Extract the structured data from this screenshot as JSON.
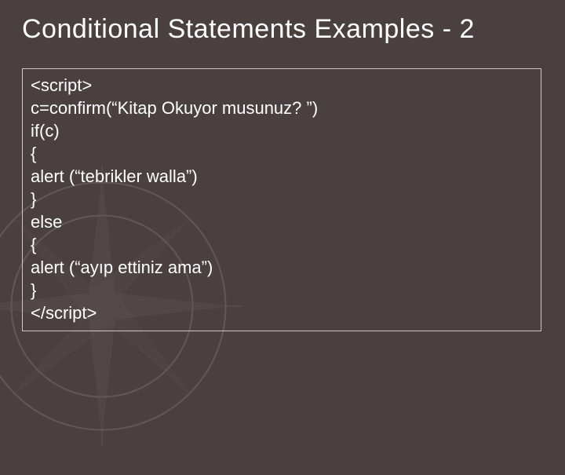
{
  "slide": {
    "title": "Conditional Statements Examples - 2",
    "code": {
      "line1": "<script>",
      "line2": "c=confirm(“Kitap Okuyor musunuz? ”)",
      "line3": "if(c)",
      "line4": "{",
      "line5": "alert (“tebrikler walla”)",
      "line6": "}",
      "line7": "else",
      "line8": "{",
      "line9": "alert (“ayıp ettiniz ama”)",
      "line10": "}",
      "line11": "</script>"
    }
  }
}
